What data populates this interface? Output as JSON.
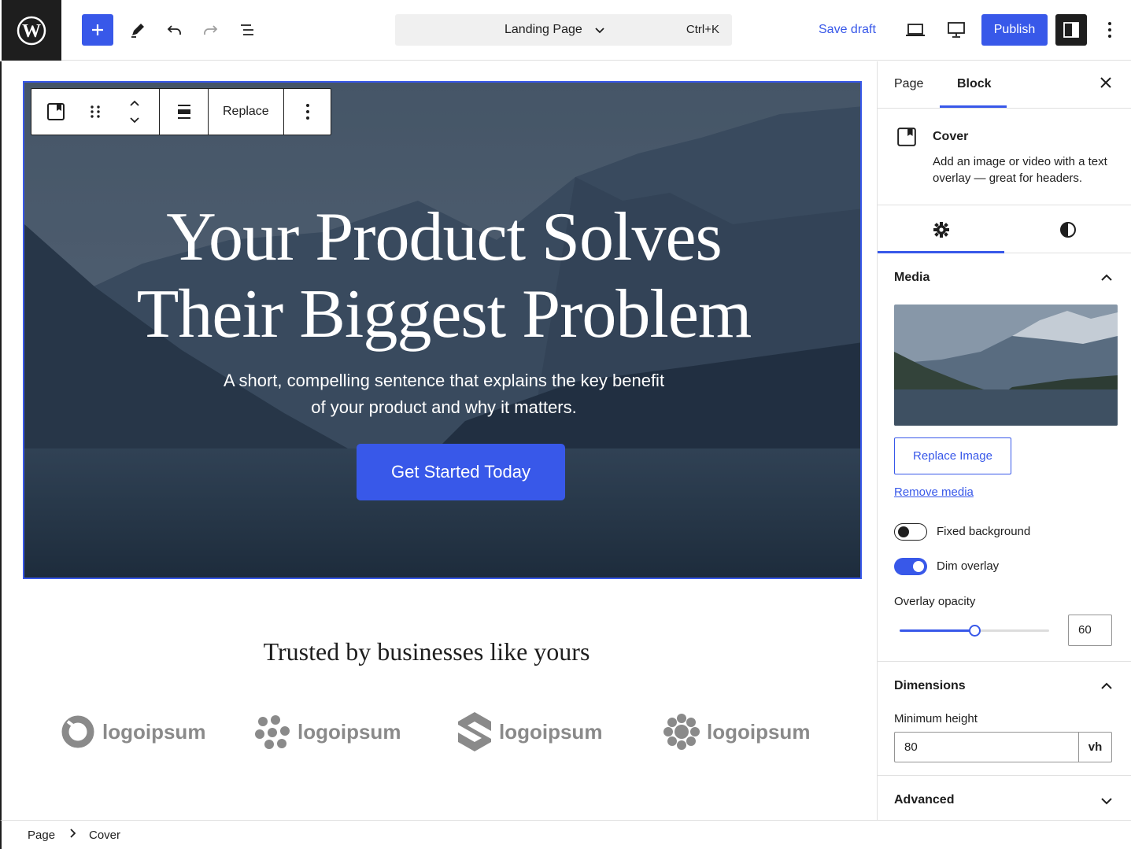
{
  "topbar": {
    "document_title": "Landing Page",
    "shortcut": "Ctrl+K",
    "save_draft": "Save draft",
    "publish": "Publish"
  },
  "block_toolbar": {
    "replace": "Replace"
  },
  "cover": {
    "title_line1": "Your Product Solves",
    "title_line2": "Their Biggest Problem",
    "subtitle_line1": "A short, compelling sentence that explains the key benefit",
    "subtitle_line2": "of your product and why it matters.",
    "cta": "Get Started Today"
  },
  "trusted": {
    "heading": "Trusted by businesses like yours",
    "logos": [
      "logoipsum",
      "logoipsum",
      "logoipsum",
      "logoipsum"
    ]
  },
  "sidebar": {
    "tabs": [
      "Page",
      "Block"
    ],
    "active_tab": "Block",
    "block_name": "Cover",
    "block_description": "Add an image or video with a text overlay — great for headers.",
    "media": {
      "title": "Media",
      "replace_image": "Replace Image",
      "remove_media": "Remove media",
      "fixed_background_label": "Fixed background",
      "fixed_background": false,
      "dim_overlay_label": "Dim overlay",
      "dim_overlay": true,
      "overlay_opacity_label": "Overlay opacity",
      "overlay_opacity": "60"
    },
    "dimensions": {
      "title": "Dimensions",
      "min_height_label": "Minimum height",
      "min_height": "80",
      "unit": "vh"
    },
    "advanced": {
      "title": "Advanced"
    }
  },
  "breadcrumb": {
    "items": [
      "Page",
      "Cover"
    ]
  },
  "colors": {
    "accent": "#3858e9",
    "dark": "#1e1e1e"
  }
}
